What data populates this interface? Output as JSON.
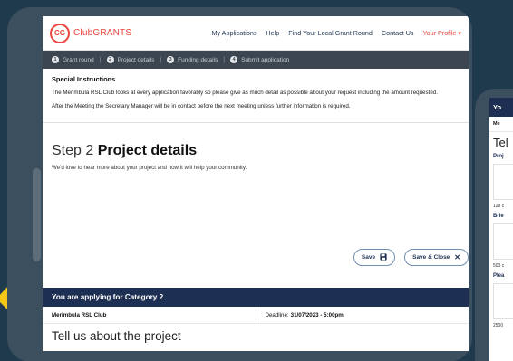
{
  "nav": {
    "logo_mark": "CG",
    "logo_text": "ClubGRANTS",
    "links": [
      "My Applications",
      "Help",
      "Find Your Local Grant Round",
      "Contact Us"
    ],
    "profile": "Your Profile"
  },
  "steps": [
    {
      "num": "1",
      "label": "Grant round"
    },
    {
      "num": "2",
      "label": "Project details"
    },
    {
      "num": "3",
      "label": "Funding details"
    },
    {
      "num": "4",
      "label": "Submit application"
    }
  ],
  "special": {
    "title": "Special Instructions",
    "p1": "The Merimbula RSL Club looks at every application favorably so please give as much detail as possible about your request including the amount requested.",
    "p2": "After the Meeting the Secretary Manager will be in contact before the next meeting unless further information is required."
  },
  "step": {
    "prefix": "Step 2",
    "title": "Project details",
    "subtitle": "We'd love to hear more about your project and how it will help your community."
  },
  "actions": {
    "save": "Save",
    "save_close": "Save & Close"
  },
  "category": {
    "banner": "You are applying for Category 2",
    "club": "Merimbula RSL Club",
    "deadline_label": "Deadline:",
    "deadline_value": "31/07/2023 - 5:00pm"
  },
  "project_heading": "Tell us about the project",
  "second_screen": {
    "bar": "Yo",
    "row": "Me",
    "heading": "Tel",
    "label1": "Proj",
    "count1": "128 c",
    "label2": "Brie",
    "count2": "500 c",
    "label3": "Plea",
    "count3": "2500"
  },
  "colors": {
    "brand_red": "#e8453c",
    "navy": "#1d2f52",
    "steps_bar": "#3c4650",
    "frame": "#3b4f5e",
    "background": "#1f3a4d",
    "arrow": "#f5c518"
  },
  "icons": [
    "save-icon",
    "close-icon",
    "chevron-down-icon",
    "arrow-icon"
  ]
}
